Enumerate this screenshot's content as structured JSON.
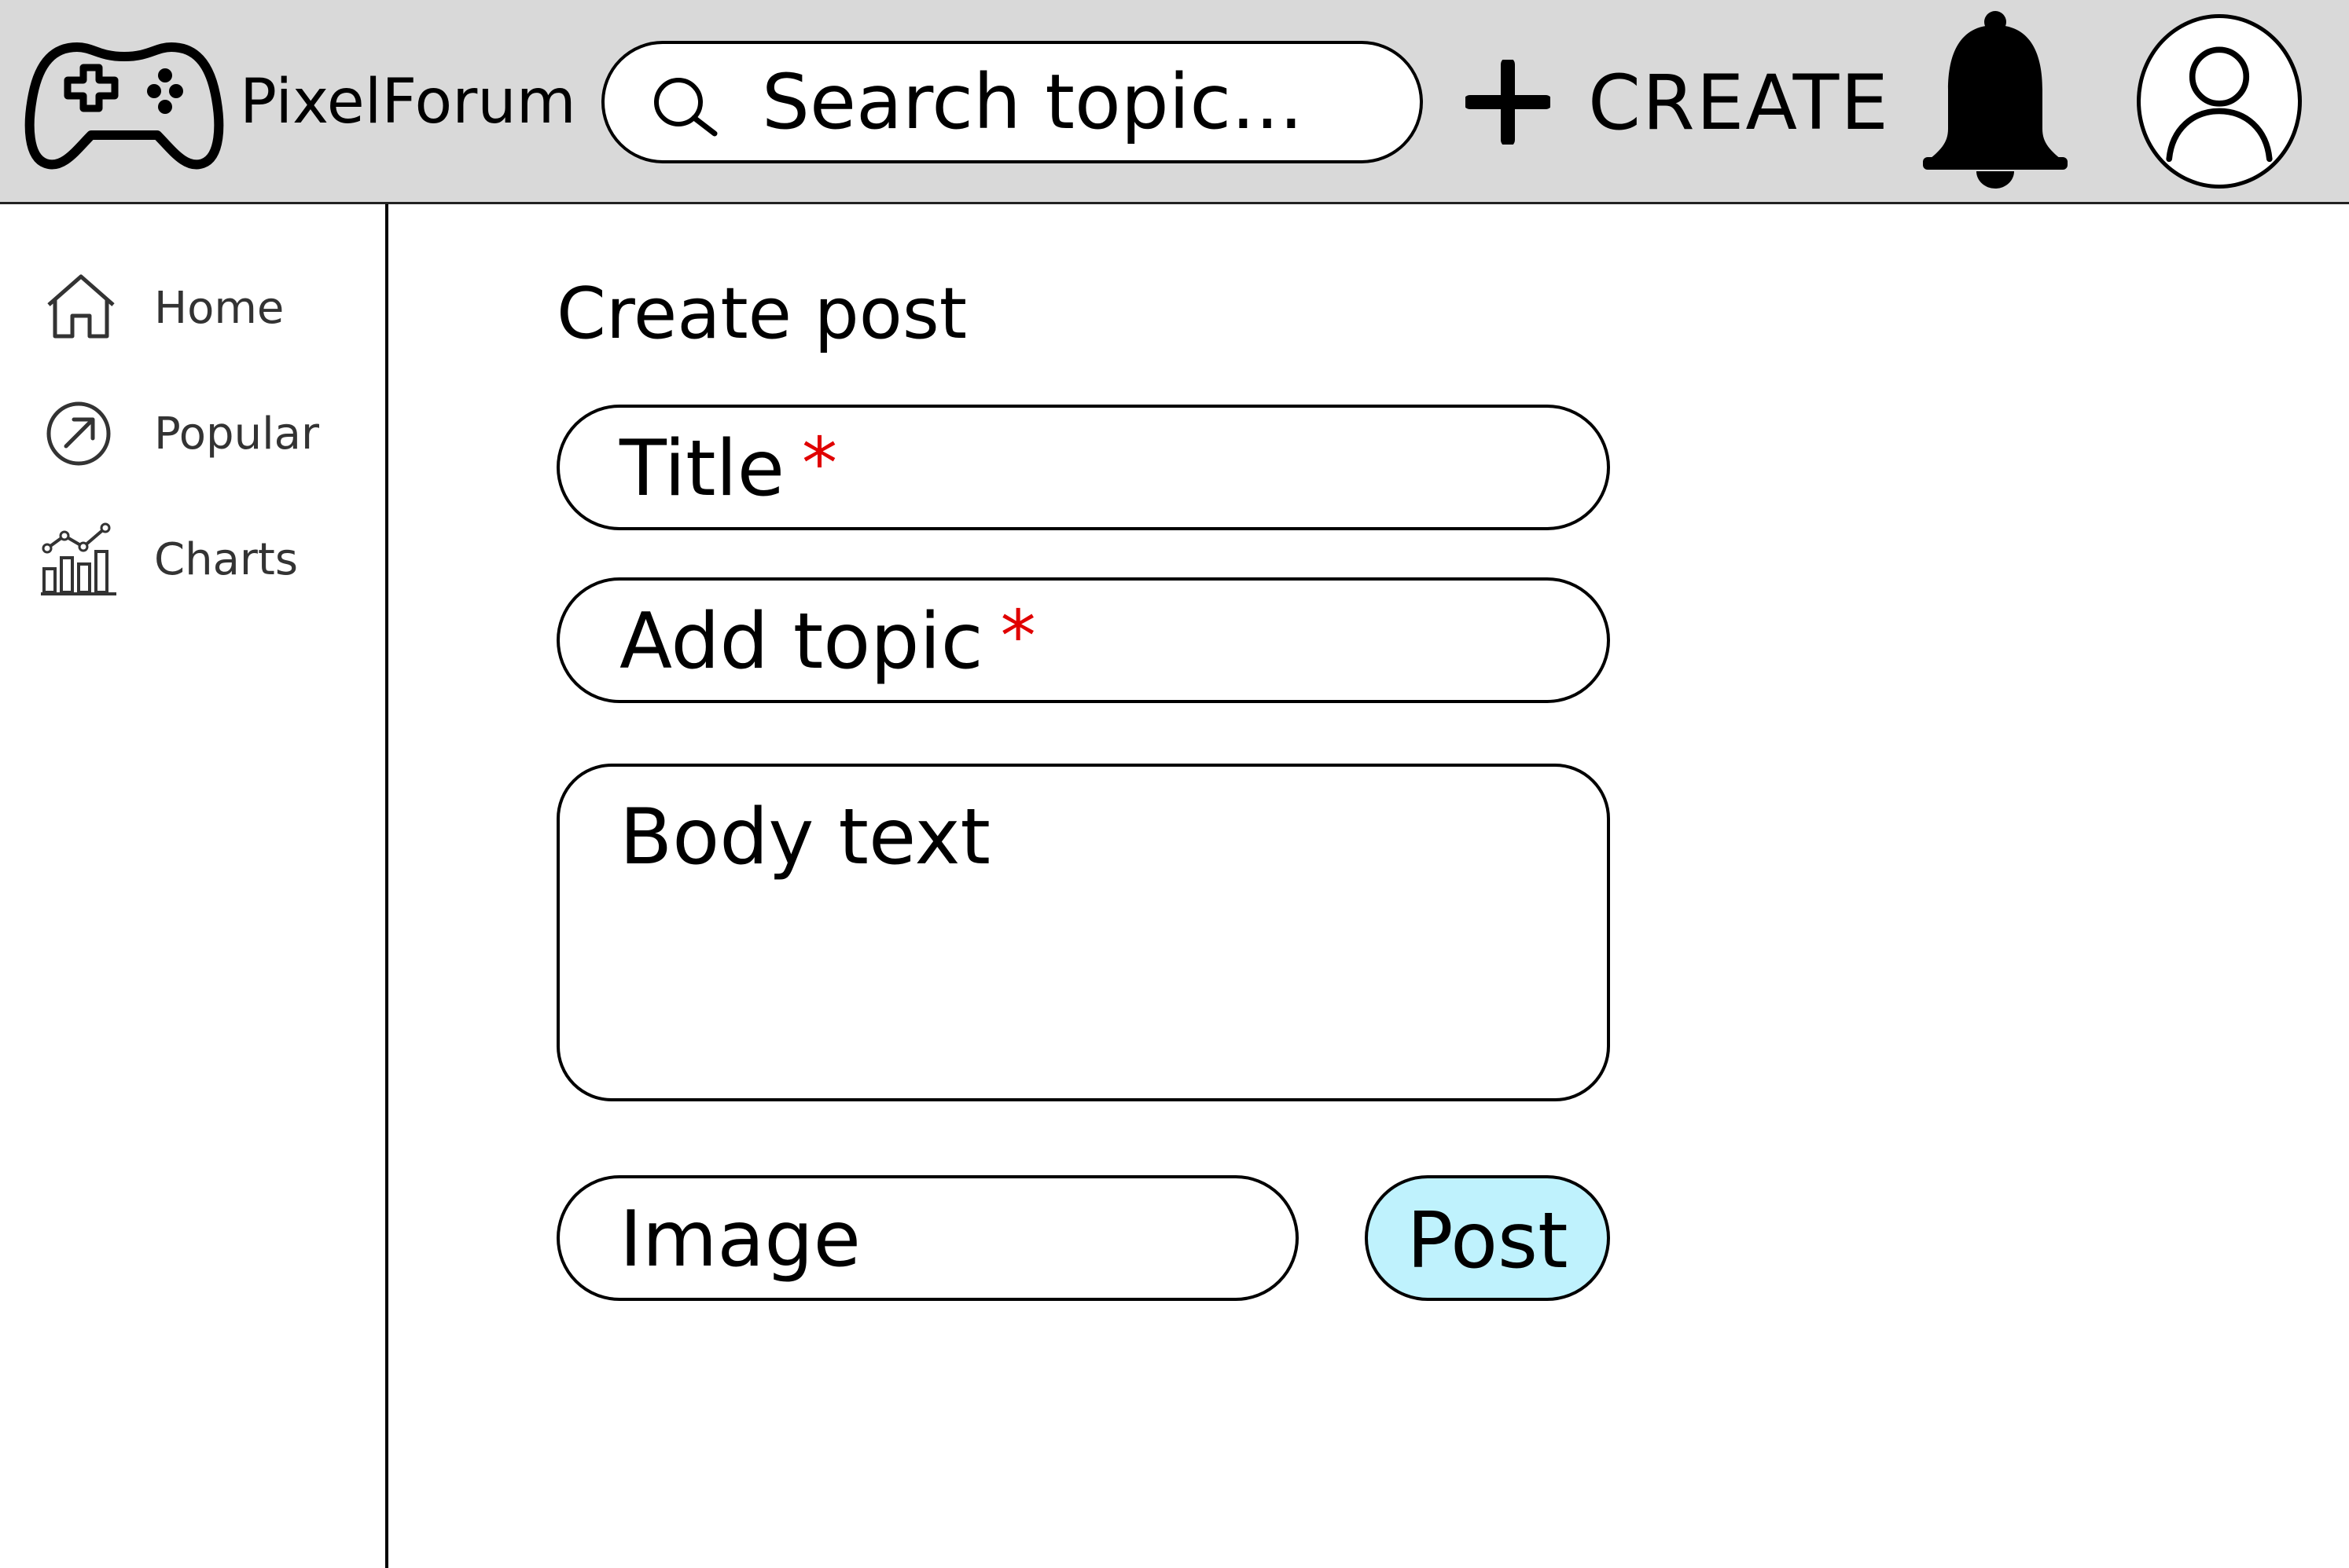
{
  "header": {
    "app_title": "PixelForum",
    "search": {
      "placeholder": "Search topic..."
    },
    "create_label": "CREATE",
    "logo_icon": "game-controller-icon",
    "notification_icon": "bell-icon",
    "avatar_icon": "user-icon"
  },
  "sidebar": {
    "items": [
      {
        "label": "Home",
        "icon": "home-icon"
      },
      {
        "label": "Popular",
        "icon": "trending-arrow-icon"
      },
      {
        "label": "Charts",
        "icon": "bar-line-chart-icon"
      }
    ]
  },
  "form": {
    "page_title": "Create post",
    "title_placeholder": "Title",
    "topic_placeholder": "Add topic",
    "required_marker": "*",
    "body_placeholder": "Body text",
    "image_placeholder": "Image",
    "post_label": "Post"
  },
  "colors": {
    "header_bg": "#d9d9d9",
    "required": "#e00000",
    "post_button_bg": "#bff2fd"
  }
}
